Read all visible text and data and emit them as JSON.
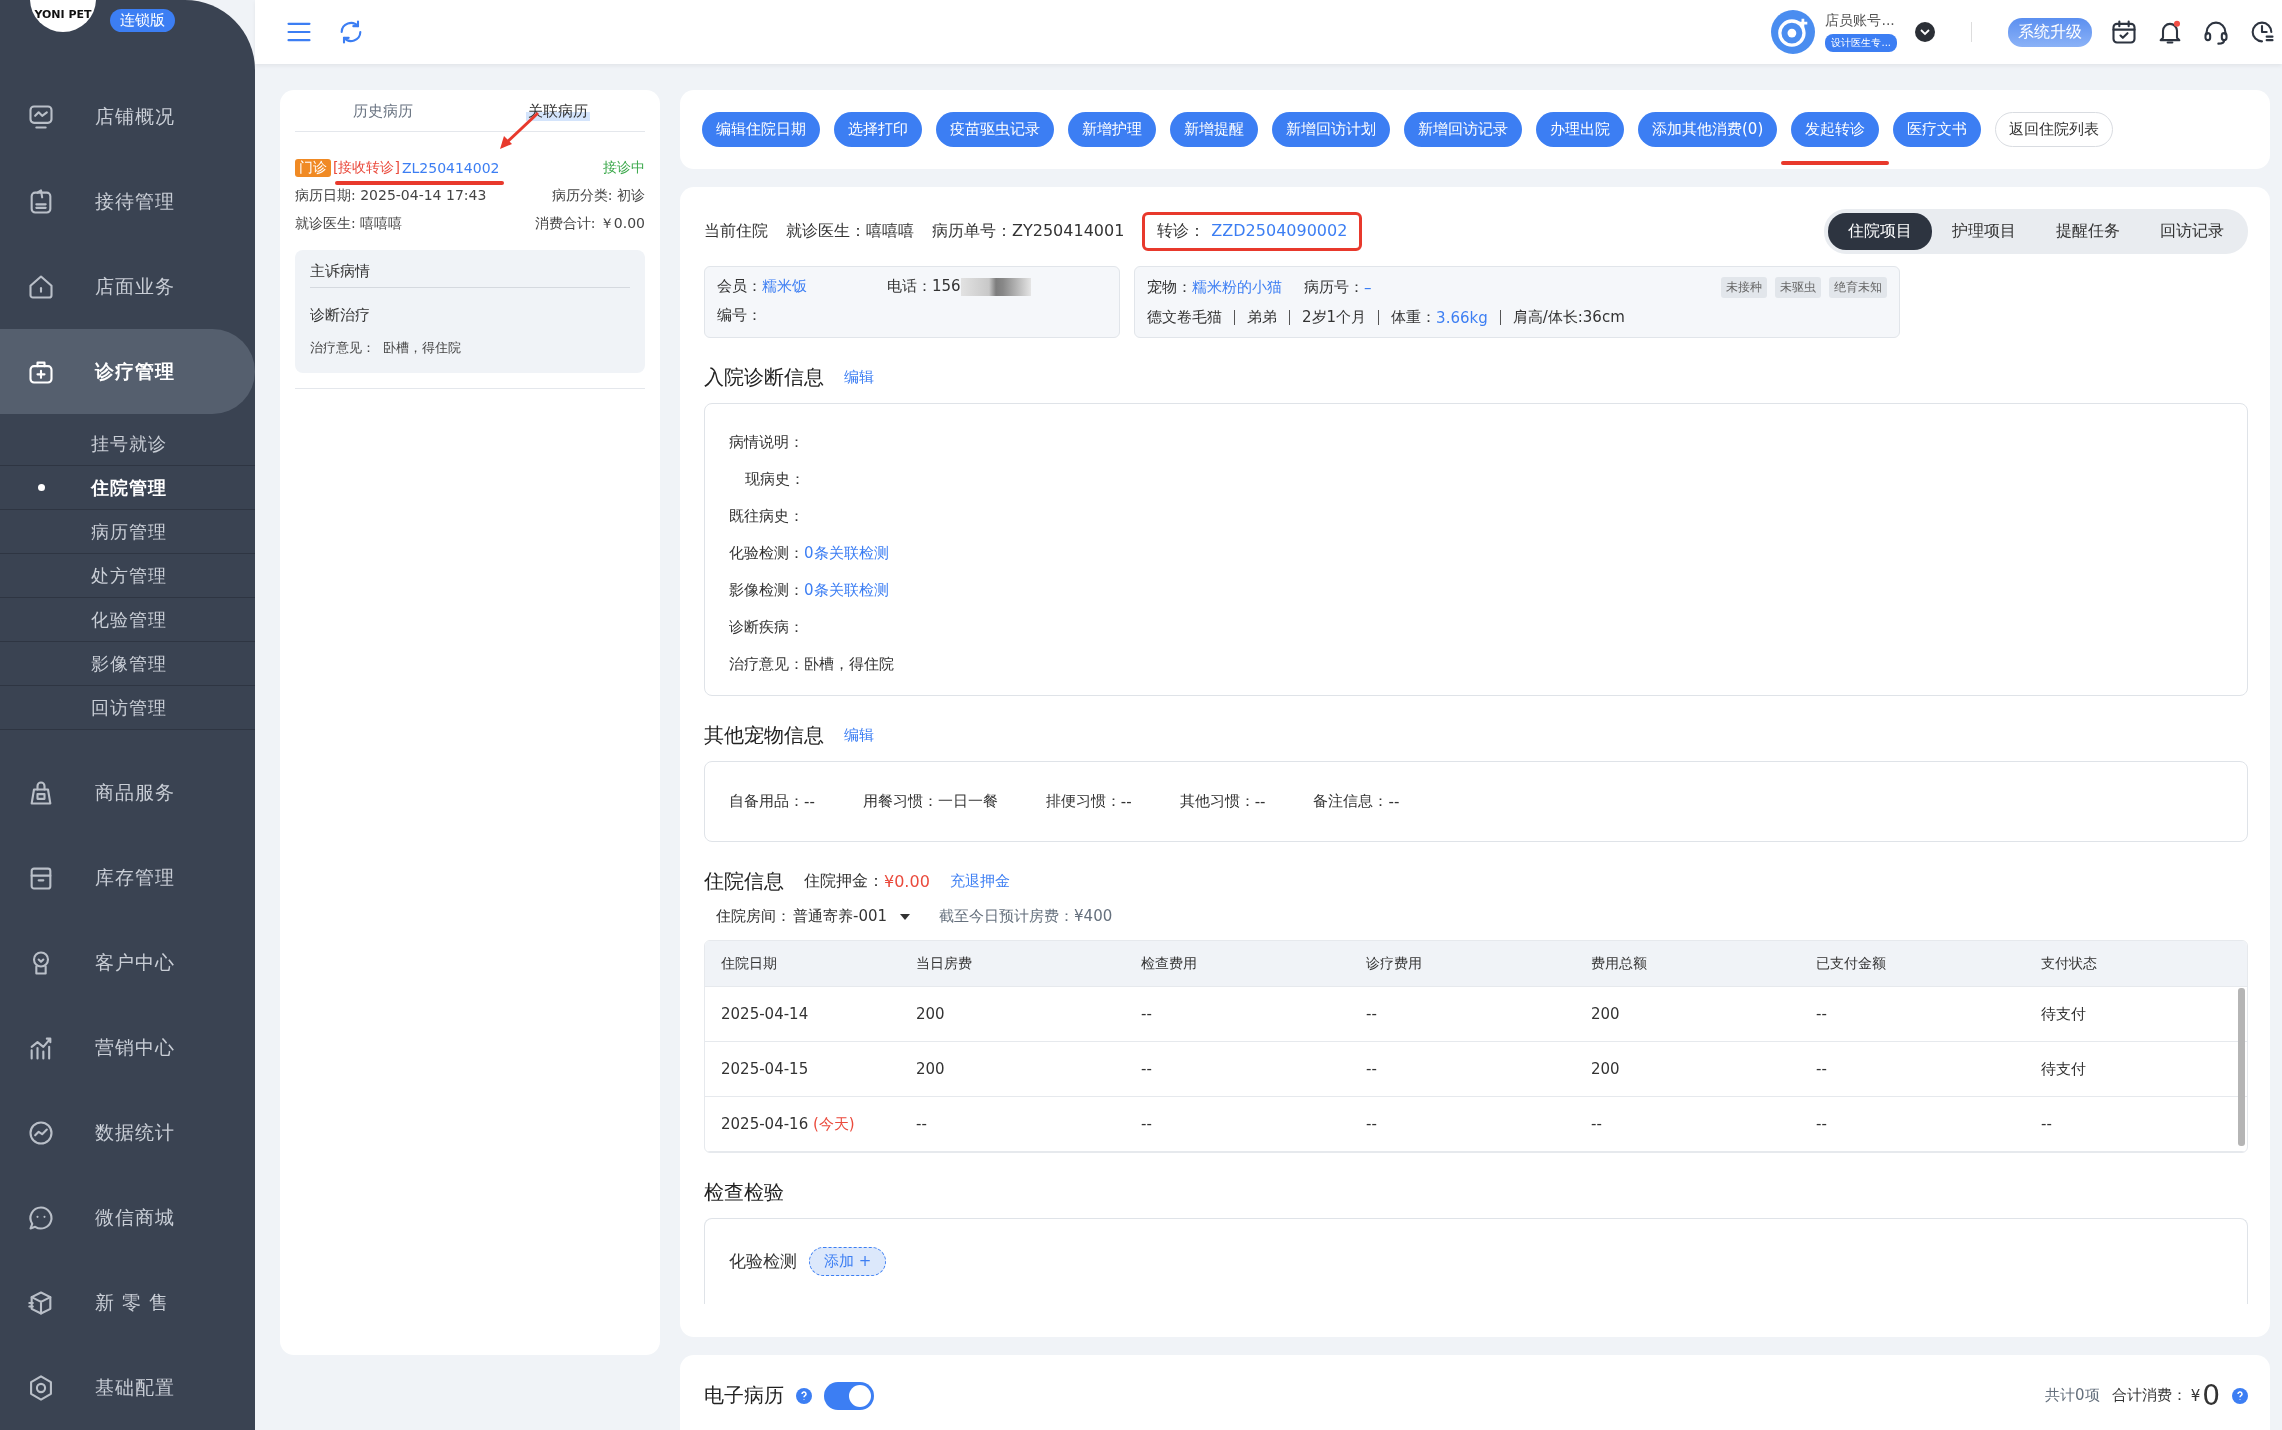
{
  "sidebar": {
    "logo_text": "YONI PET",
    "edition_badge": "连锁版",
    "items": [
      {
        "label": "店铺概况",
        "selected": false
      },
      {
        "label": "接待管理",
        "selected": false
      },
      {
        "label": "店面业务",
        "selected": false
      },
      {
        "label": "诊疗管理",
        "selected": true,
        "children": [
          {
            "label": "挂号就诊",
            "selected": false
          },
          {
            "label": "住院管理",
            "selected": true
          },
          {
            "label": "病历管理",
            "selected": false
          },
          {
            "label": "处方管理",
            "selected": false
          },
          {
            "label": "化验管理",
            "selected": false
          },
          {
            "label": "影像管理",
            "selected": false
          },
          {
            "label": "回访管理",
            "selected": false
          }
        ]
      },
      {
        "label": "商品服务",
        "selected": false
      },
      {
        "label": "库存管理",
        "selected": false
      },
      {
        "label": "客户中心",
        "selected": false
      },
      {
        "label": "营销中心",
        "selected": false
      },
      {
        "label": "数据统计",
        "selected": false
      },
      {
        "label": "微信商城",
        "selected": false
      },
      {
        "label": "新 零 售",
        "selected": false
      },
      {
        "label": "基础配置",
        "selected": false
      }
    ]
  },
  "top_bar": {
    "user_name": "店员账号...",
    "role_badge": "设计医生专...",
    "upgrade_button": "系统升级",
    "has_notification": true
  },
  "record_panel": {
    "tabs": [
      {
        "label": "历史病历",
        "selected": false
      },
      {
        "label": "关联病历",
        "selected": true
      }
    ],
    "record": {
      "type_tag": "门诊",
      "transfer_tag": "[接收转诊]",
      "record_id": "ZL250414002",
      "status": "接诊中",
      "annotated": true,
      "fields": [
        "病历日期: 2025-04-14 17:43",
        "病历分类: 初诊",
        "就诊医生: 嘻嘻嘻",
        "消费合计: ￥0.00"
      ],
      "summary": {
        "complaint_title": "主诉病情",
        "diagnosis_title": "诊断治疗",
        "opinion_label": "治疗意见：",
        "opinion_value": "卧槽，得住院"
      }
    }
  },
  "actions": [
    {
      "label": "编辑住院日期",
      "kind": "primary",
      "annotated": false
    },
    {
      "label": "选择打印",
      "kind": "primary",
      "annotated": false
    },
    {
      "label": "疫苗驱虫记录",
      "kind": "primary",
      "annotated": false
    },
    {
      "label": "新增护理",
      "kind": "primary",
      "annotated": false
    },
    {
      "label": "新增提醒",
      "kind": "primary",
      "annotated": false
    },
    {
      "label": "新增回访计划",
      "kind": "primary",
      "annotated": false
    },
    {
      "label": "新增回访记录",
      "kind": "primary",
      "annotated": false
    },
    {
      "label": "办理出院",
      "kind": "primary",
      "annotated": false
    },
    {
      "label": "添加其他消费(0)",
      "kind": "primary",
      "annotated": false
    },
    {
      "label": "发起转诊",
      "kind": "primary",
      "annotated": true
    },
    {
      "label": "医疗文书",
      "kind": "primary",
      "annotated": false
    },
    {
      "label": "返回住院列表",
      "kind": "outline",
      "annotated": false
    }
  ],
  "info_line": {
    "title": "当前住院",
    "doctor": "就诊医生：嘻嘻嘻",
    "record_no": "病历单号：ZY250414001",
    "transfer_label": "转诊：",
    "transfer_value": "ZZD2504090002",
    "transfer_annotated": true
  },
  "view_tabs": [
    {
      "label": "住院项目",
      "selected": true
    },
    {
      "label": "护理项目",
      "selected": false
    },
    {
      "label": "提醒任务",
      "selected": false
    },
    {
      "label": "回访记录",
      "selected": false
    }
  ],
  "member_card": {
    "member_label": "会员：",
    "member_name": "糯米饭",
    "phone_label": "电话：156",
    "number_label": "编号："
  },
  "pet_card": {
    "pet_label": "宠物：",
    "pet_name": "糯米粉的小猫",
    "record_label": "病历号：",
    "record_value": "–",
    "tags": [
      "未接种",
      "未驱虫",
      "绝育未知"
    ],
    "details": [
      {
        "text": "德文卷毛猫",
        "kind": "plain"
      },
      {
        "text": "弟弟",
        "kind": "plain"
      },
      {
        "text": "2岁1个月",
        "kind": "plain"
      },
      {
        "label": "体重：",
        "text": "3.66kg",
        "kind": "link"
      },
      {
        "text": "肩高/体长:36cm",
        "kind": "plain"
      }
    ]
  },
  "admission": {
    "title": "入院诊断信息",
    "edit_link": "编辑",
    "fields": [
      {
        "label": "病情说明："
      },
      {
        "label": "现病史：",
        "indent": true
      },
      {
        "label": "既往病史："
      },
      {
        "label": "化验检测：",
        "value": "0条关联检测",
        "kind": "link"
      },
      {
        "label": "影像检测：",
        "value": "0条关联检测",
        "kind": "link"
      },
      {
        "label": "诊断疾病："
      },
      {
        "label": "治疗意见：",
        "value": "卧槽，得住院",
        "kind": "plain"
      }
    ]
  },
  "other_info": {
    "title": "其他宠物信息",
    "edit_link": "编辑",
    "fields": [
      {
        "label": "自备用品：",
        "value": "--"
      },
      {
        "label": "用餐习惯：",
        "value": "一日一餐"
      },
      {
        "label": "排便习惯：",
        "value": "--"
      },
      {
        "label": "其他习惯：",
        "value": "--"
      },
      {
        "label": "备注信息：",
        "value": "--"
      }
    ]
  },
  "hospital": {
    "title": "住院信息",
    "deposit_label": "住院押金：",
    "deposit_value": "¥0.00",
    "deposit_link": "充退押金",
    "room_label": "住院房间：",
    "room_value": "普通寄养-001",
    "fee_estimate": "截至今日预计房费：¥400",
    "table": {
      "columns": [
        "住院日期",
        "当日房费",
        "检查费用",
        "诊疗费用",
        "费用总额",
        "已支付金额",
        "支付状态"
      ],
      "rows": [
        {
          "cells": [
            "2025-04-14",
            "200",
            "--",
            "--",
            "200",
            "--",
            "待支付"
          ]
        },
        {
          "cells": [
            "2025-04-15",
            "200",
            "--",
            "--",
            "200",
            "--",
            "待支付"
          ]
        },
        {
          "note": "(今天)",
          "cells": [
            "2025-04-16",
            "--",
            "--",
            "--",
            "--",
            "--",
            "--"
          ]
        }
      ]
    }
  },
  "exams": {
    "title": "检查检验",
    "lab_label": "化验检测",
    "add_button": "添加 +"
  },
  "footer": {
    "title": "电子病历",
    "toggle_on": true,
    "count": "共计0项",
    "total_label": "合计消费：",
    "total_currency": "¥",
    "total_value": "0"
  }
}
